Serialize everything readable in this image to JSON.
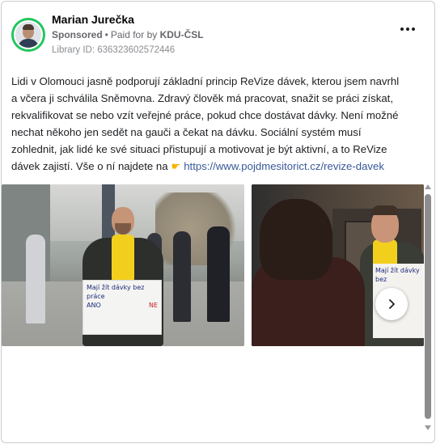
{
  "post": {
    "author_name": "Marian Jurečka",
    "sponsored_label": "Sponsored",
    "paid_for_prefix": "Paid for by",
    "paid_by": "KDU-ČSL",
    "library_id": "Library ID: 636323602572446",
    "text_lines": [
      "Lidi v Olomouci jasně podporují základní princip ReVize dávek, kterou jsem navrhl",
      "a včera ji schválila Sněmovna. Zdravý člověk má pracovat, snažit se práci získat,",
      "rekvalifikovat se nebo vzít veřejné práce, pokud chce dostávat dávky. Není možné",
      "nechat někoho jen sedět na gauči a čekat na dávku. Sociální systém musí",
      "zohlednit, jak lidé ke své situaci přistupují a motivovat je být aktivní, a to ReVize"
    ],
    "last_line_text": "dávek zajistí. Vše o ní najdete na",
    "link_text": "https://www.pojdmesitorict.cz/revize-davek"
  },
  "media": {
    "sign_1_line": "Mají žít dávky bez práce",
    "sign_1_yes": "ANO",
    "sign_1_no": "NE",
    "sign_2_line": "Mají žít dávky bez"
  },
  "icons": {
    "more": "more-horizontal-icon",
    "pointing": "pointing-right-icon",
    "next": "chevron-right-icon"
  },
  "colors": {
    "avatar_ring": "#22c55e",
    "link": "#385898",
    "scarf": "#f2cf1d"
  }
}
